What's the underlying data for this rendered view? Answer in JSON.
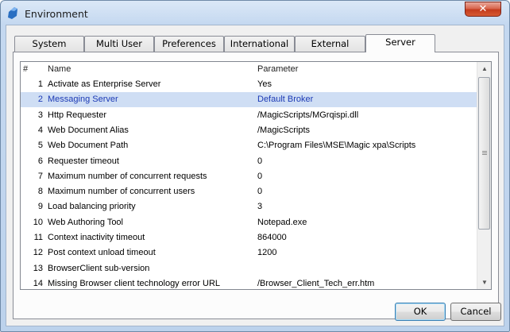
{
  "window": {
    "title": "Environment",
    "close_glyph": "✕"
  },
  "tabs": [
    {
      "label": "System",
      "active": false
    },
    {
      "label": "Multi User",
      "active": false
    },
    {
      "label": "Preferences",
      "active": false
    },
    {
      "label": "International",
      "active": false
    },
    {
      "label": "External",
      "active": false
    },
    {
      "label": "Server",
      "active": true
    }
  ],
  "table": {
    "columns": {
      "num": "#",
      "name": "Name",
      "param": "Parameter"
    },
    "selected_row": 2,
    "rows": [
      {
        "num": "1",
        "name": "Activate as Enterprise Server",
        "param": "Yes"
      },
      {
        "num": "2",
        "name": "Messaging Server",
        "param": "Default Broker"
      },
      {
        "num": "3",
        "name": "Http Requester",
        "param": "/MagicScripts/MGrqispi.dll"
      },
      {
        "num": "4",
        "name": "Web Document Alias",
        "param": "/MagicScripts"
      },
      {
        "num": "5",
        "name": "Web Document Path",
        "param": "C:\\Program Files\\MSE\\Magic xpa\\Scripts"
      },
      {
        "num": "6",
        "name": "Requester timeout",
        "param": "0"
      },
      {
        "num": "7",
        "name": "Maximum number of concurrent requests",
        "param": "0"
      },
      {
        "num": "8",
        "name": "Maximum number of concurrent users",
        "param": "0"
      },
      {
        "num": "9",
        "name": "Load balancing priority",
        "param": "3"
      },
      {
        "num": "10",
        "name": "Web Authoring Tool",
        "param": "Notepad.exe"
      },
      {
        "num": "11",
        "name": "Context inactivity timeout",
        "param": "864000"
      },
      {
        "num": "12",
        "name": "Post context unload timeout",
        "param": "1200"
      },
      {
        "num": "13",
        "name": "BrowserClient sub-version",
        "param": ""
      },
      {
        "num": "14",
        "name": "Missing Browser client technology error URL",
        "param": "/Browser_Client_Tech_err.htm"
      }
    ]
  },
  "buttons": {
    "ok": "OK",
    "cancel": "Cancel"
  },
  "icons": {
    "app": "magic-xpa-icon",
    "scroll_up": "scroll-up-arrow-icon",
    "scroll_down": "scroll-down-arrow-icon"
  },
  "colors": {
    "selected_row_bg": "#cfdef4",
    "selected_row_text": "#1c3ab5",
    "close_button": "#c43b1d"
  }
}
